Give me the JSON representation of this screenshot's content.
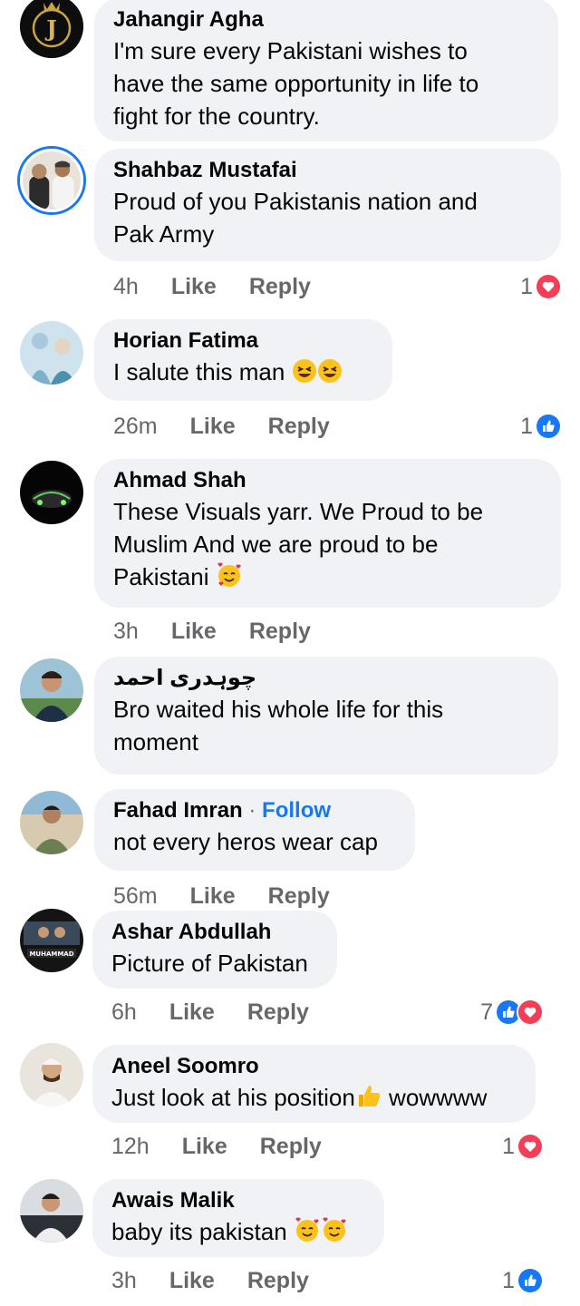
{
  "colors": {
    "bubble": "#f0f2f5",
    "meta": "#65676b",
    "accent": "#1877f2",
    "love": "#f33e58"
  },
  "comments": [
    {
      "name": "Jahangir Agha",
      "lines": [
        "I'm sure every Pakistani wishes to",
        "have the same opportunity in life to",
        "fight for the country."
      ],
      "avatar_icon": "gold-j-logo-avatar"
    },
    {
      "name": "Shahbaz Mustafai",
      "lines": [
        "Proud of you Pakistanis nation and",
        "Pak Army"
      ],
      "time": "4h",
      "like": "Like",
      "reply": "Reply",
      "count": "1",
      "reactions": [
        "love-reaction-icon"
      ]
    },
    {
      "name": "Horian Fatima",
      "lines": [
        "I salute this man"
      ],
      "emoji": "laughing-emoji-icon x2",
      "time": "26m",
      "like": "Like",
      "reply": "Reply",
      "count": "1",
      "reactions": [
        "like-reaction-icon"
      ]
    },
    {
      "name": "Ahmad Shah",
      "lines": [
        "These Visuals yarr. We Proud to be",
        "Muslim And we are proud to be",
        "Pakistani"
      ],
      "emoji": "smiling-hearts-emoji-icon",
      "time": "3h",
      "like": "Like",
      "reply": "Reply"
    },
    {
      "name": "چوہدری احمد",
      "lines": [
        "Bro waited his whole life for this",
        "moment"
      ]
    },
    {
      "name": "Fahad Imran",
      "follow": "Follow",
      "separator": "·",
      "lines": [
        "not every heros wear cap"
      ],
      "time": "56m",
      "like": "Like",
      "reply": "Reply"
    },
    {
      "name": "Ashar Abdullah",
      "lines": [
        "Picture of Pakistan"
      ],
      "avatar_text": "MUHAMMAD",
      "time": "6h",
      "like": "Like",
      "reply": "Reply",
      "count": "7",
      "reactions": [
        "like-reaction-icon",
        "love-reaction-icon"
      ]
    },
    {
      "name": "Aneel Soomro",
      "lines": [
        "Just look at his position",
        "wowwww"
      ],
      "emoji": "thumbs-up-emoji-icon",
      "time": "12h",
      "like": "Like",
      "reply": "Reply",
      "count": "1",
      "reactions": [
        "love-reaction-icon"
      ]
    },
    {
      "name": "Awais Malik",
      "lines": [
        "baby its pakistan"
      ],
      "emoji": "smiling-hearts-emoji-icon x2",
      "time": "3h",
      "like": "Like",
      "reply": "Reply",
      "count": "1",
      "reactions": [
        "like-reaction-icon"
      ]
    }
  ]
}
